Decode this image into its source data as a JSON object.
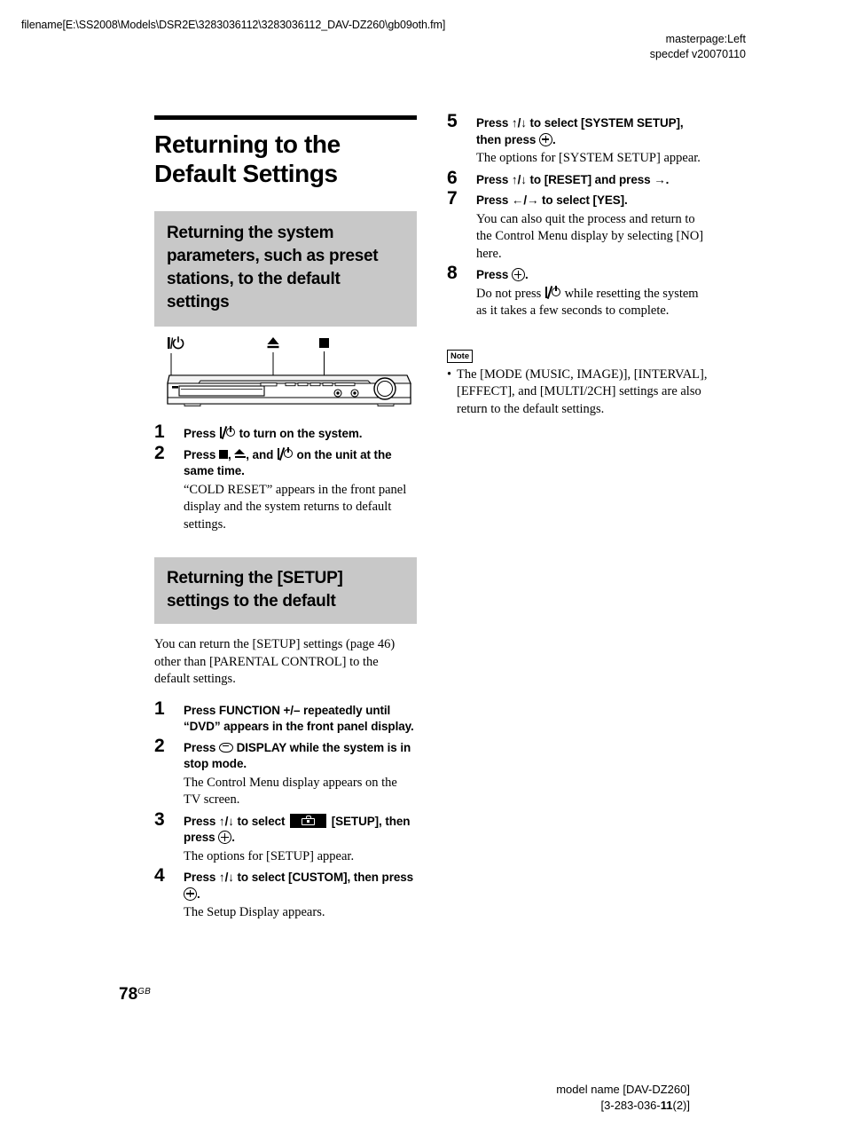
{
  "page": {
    "header_filename": "filename[E:\\SS2008\\Models\\DSR2E\\3283036112\\3283036112_DAV-DZ260\\gb09oth.fm]",
    "header_masterpage": "masterpage:Left",
    "header_specdef": "specdef v20070110",
    "page_number": "78",
    "page_number_suffix": "GB",
    "footer_model": "model name [DAV-DZ260]",
    "footer_part_prefix": "[3-283-036-",
    "footer_part_bold": "11",
    "footer_part_suffix": "(2)]"
  },
  "main_title": "Returning to the Default Settings",
  "section_one": {
    "heading": "Returning the system parameters, such as preset stations, to the default settings",
    "figure": {
      "caption_power": "power-symbol",
      "caption_eject": "eject-symbol",
      "caption_stop": "stop-symbol",
      "device": "dvd-receiver-front-panel"
    },
    "steps": [
      {
        "num": "1",
        "title_pre": "Press ",
        "title_post": " to turn on the system.",
        "body": ""
      },
      {
        "num": "2",
        "title_pre": "Press ",
        "title_mid": ", ",
        "title_mid2": ", and ",
        "title_post": " on the unit at the same time.",
        "body": "“COLD RESET” appears in the front panel display and the system returns to default settings."
      }
    ]
  },
  "section_two": {
    "heading": "Returning the [SETUP] settings to the default",
    "intro": "You can return the [SETUP] settings (page 46) other than [PARENTAL CONTROL] to the default settings.",
    "steps": [
      {
        "num": "1",
        "title": "Press FUNCTION +/– repeatedly until “DVD” appears in the front panel display.",
        "body": ""
      },
      {
        "num": "2",
        "title_pre": "Press ",
        "title_post": " DISPLAY while the system is in stop mode.",
        "body": "The Control Menu display appears on the TV screen."
      },
      {
        "num": "3",
        "title_pre": "Press ↑/↓ to select ",
        "title_mid": " [SETUP], then press ",
        "title_post": ".",
        "body": "The options for [SETUP] appear."
      },
      {
        "num": "4",
        "title_pre": "Press ↑/↓ to select [CUSTOM], then press ",
        "title_post": ".",
        "body": "The Setup Display appears."
      },
      {
        "num": "5",
        "title_pre": "Press ↑/↓ to select [SYSTEM SETUP], then press ",
        "title_post": ".",
        "body": "The options for [SYSTEM SETUP] appear."
      },
      {
        "num": "6",
        "title": "Press ↑/↓ to [RESET] and press →.",
        "body": ""
      },
      {
        "num": "7",
        "title": "Press ←/→ to select [YES].",
        "body": "You can also quit the process and return to the Control Menu display by selecting [NO] here."
      },
      {
        "num": "8",
        "title_pre": "Press ",
        "title_post": ".",
        "body_pre": "Do not press ",
        "body_post": " while resetting the system as it takes a few seconds to complete."
      }
    ],
    "note": {
      "label": "Note",
      "item": "The [MODE (MUSIC, IMAGE)], [INTERVAL], [EFFECT], and [MULTI/2CH] settings are also return to the default settings."
    }
  }
}
